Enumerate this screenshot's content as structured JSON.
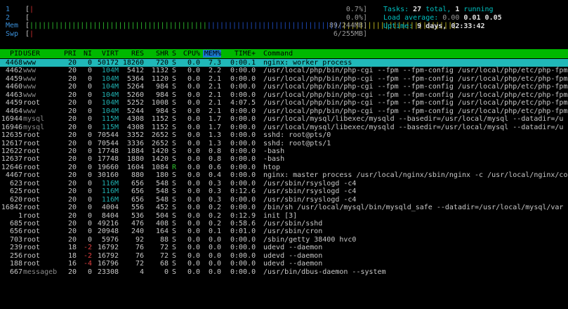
{
  "meters": [
    {
      "label": "1",
      "value": "0.7%]",
      "segments": [
        {
          "t": "|",
          "c": "#d03030"
        }
      ]
    },
    {
      "label": "2",
      "value": "0.0%]",
      "segments": []
    },
    {
      "label": "Mem",
      "value": "89/244MB]",
      "segments": [
        {
          "t": "||||||||||||||||||||||||||||||||||||||||||",
          "c": "#2fc02f"
        },
        {
          "t": "||||||||||||||||||||||||||||||||",
          "c": "#2050c8"
        },
        {
          "t": "|||||||||||||||||||||||||||",
          "c": "#c8c020"
        }
      ]
    },
    {
      "label": "Swp",
      "value": "6/255MB]",
      "segments": [
        {
          "t": "|",
          "c": "#d03030"
        }
      ]
    }
  ],
  "summary": {
    "tasks_label": "Tasks: ",
    "tasks_total": "27",
    "tasks_mid": " total, ",
    "tasks_running": "1",
    "tasks_end": " running",
    "load_label": "Load average: ",
    "load_1": "0.00",
    "load_5": "0.01",
    "load_15": "0.05",
    "uptime_label": "Uptime: ",
    "uptime_value": "9 days, 02:33:42"
  },
  "columns": {
    "pid": "PID",
    "user": "USER",
    "pri": "PRI",
    "ni": "NI",
    "virt": "VIRT",
    "res": "RES",
    "shr": "SHR",
    "s": "S",
    "cpu": "CPU%",
    "mem": "MEM%",
    "time": "TIME+",
    "command": "Command"
  },
  "processes": [
    {
      "pid": "4468",
      "user": "www",
      "pri": "20",
      "ni": "0",
      "virt": "50172",
      "res": "18260",
      "shr": "720",
      "s": "S",
      "cpu": "0.0",
      "mem": "7.3",
      "time": "0:00.13",
      "cmd": "nginx: worker process",
      "uc": "",
      "vc": "",
      "sc": ""
    },
    {
      "pid": "4462",
      "user": "www",
      "pri": "20",
      "ni": "0",
      "virt": "104M",
      "res": "5412",
      "shr": "1132",
      "s": "S",
      "cpu": "0.0",
      "mem": "2.2",
      "time": "0:00.01",
      "cmd": "/usr/local/php/bin/php-cgi --fpm --fpm-config /usr/local/php/etc/php-fpm",
      "uc": "gray",
      "vc": "cyan",
      "sc": ""
    },
    {
      "pid": "4459",
      "user": "www",
      "pri": "20",
      "ni": "0",
      "virt": "104M",
      "res": "5364",
      "shr": "1120",
      "s": "S",
      "cpu": "0.0",
      "mem": "2.1",
      "time": "0:00.01",
      "cmd": "/usr/local/php/bin/php-cgi --fpm --fpm-config /usr/local/php/etc/php-fpm",
      "uc": "gray",
      "vc": "cyan",
      "sc": ""
    },
    {
      "pid": "4460",
      "user": "www",
      "pri": "20",
      "ni": "0",
      "virt": "104M",
      "res": "5264",
      "shr": "984",
      "s": "S",
      "cpu": "0.0",
      "mem": "2.1",
      "time": "0:00.01",
      "cmd": "/usr/local/php/bin/php-cgi --fpm --fpm-config /usr/local/php/etc/php-fpm",
      "uc": "gray",
      "vc": "cyan",
      "sc": ""
    },
    {
      "pid": "4463",
      "user": "www",
      "pri": "20",
      "ni": "0",
      "virt": "104M",
      "res": "5260",
      "shr": "984",
      "s": "S",
      "cpu": "0.0",
      "mem": "2.1",
      "time": "0:00.01",
      "cmd": "/usr/local/php/bin/php-cgi --fpm --fpm-config /usr/local/php/etc/php-fpm",
      "uc": "gray",
      "vc": "cyan",
      "sc": ""
    },
    {
      "pid": "4459",
      "user": "root",
      "pri": "20",
      "ni": "0",
      "virt": "104M",
      "res": "5252",
      "shr": "1008",
      "s": "S",
      "cpu": "0.0",
      "mem": "2.1",
      "time": "4:07.55",
      "cmd": "/usr/local/php/bin/php-cgi --fpm --fpm-config /usr/local/php/etc/php-fpm",
      "uc": "",
      "vc": "cyan",
      "sc": ""
    },
    {
      "pid": "4464",
      "user": "www",
      "pri": "20",
      "ni": "0",
      "virt": "104M",
      "res": "5244",
      "shr": "984",
      "s": "S",
      "cpu": "0.0",
      "mem": "2.1",
      "time": "0:00.01",
      "cmd": "/usr/local/php/bin/php-cgi --fpm --fpm-config /usr/local/php/etc/php-fpm",
      "uc": "gray",
      "vc": "cyan",
      "sc": ""
    },
    {
      "pid": "16944",
      "user": "mysql",
      "pri": "20",
      "ni": "0",
      "virt": "115M",
      "res": "4308",
      "shr": "1152",
      "s": "S",
      "cpu": "0.0",
      "mem": "1.7",
      "time": "0:00.01",
      "cmd": "/usr/local/mysql/libexec/mysqld --basedir=/usr/local/mysql --datadir=/u",
      "uc": "gray",
      "vc": "cyan",
      "sc": ""
    },
    {
      "pid": "16946",
      "user": "mysql",
      "pri": "20",
      "ni": "0",
      "virt": "115M",
      "res": "4308",
      "shr": "1152",
      "s": "S",
      "cpu": "0.0",
      "mem": "1.7",
      "time": "0:00.00",
      "cmd": "/usr/local/mysql/libexec/mysqld --basedir=/usr/local/mysql --datadir=/u",
      "uc": "gray",
      "vc": "cyan",
      "sc": ""
    },
    {
      "pid": "12635",
      "user": "root",
      "pri": "20",
      "ni": "0",
      "virt": "70544",
      "res": "3352",
      "shr": "2652",
      "s": "S",
      "cpu": "0.0",
      "mem": "1.3",
      "time": "0:00.04",
      "cmd": "sshd: root@pts/0",
      "uc": "",
      "vc": "",
      "sc": ""
    },
    {
      "pid": "12617",
      "user": "root",
      "pri": "20",
      "ni": "0",
      "virt": "70544",
      "res": "3336",
      "shr": "2652",
      "s": "S",
      "cpu": "0.0",
      "mem": "1.3",
      "time": "0:00.04",
      "cmd": "sshd: root@pts/1",
      "uc": "",
      "vc": "",
      "sc": ""
    },
    {
      "pid": "12622",
      "user": "root",
      "pri": "20",
      "ni": "0",
      "virt": "17748",
      "res": "1884",
      "shr": "1420",
      "s": "S",
      "cpu": "0.0",
      "mem": "0.8",
      "time": "0:00.01",
      "cmd": "-bash",
      "uc": "",
      "vc": "",
      "sc": ""
    },
    {
      "pid": "12637",
      "user": "root",
      "pri": "20",
      "ni": "0",
      "virt": "17748",
      "res": "1880",
      "shr": "1420",
      "s": "S",
      "cpu": "0.0",
      "mem": "0.8",
      "time": "0:00.01",
      "cmd": "-bash",
      "uc": "",
      "vc": "",
      "sc": ""
    },
    {
      "pid": "12646",
      "user": "root",
      "pri": "20",
      "ni": "0",
      "virt": "19660",
      "res": "1604",
      "shr": "1084",
      "s": "R",
      "cpu": "0.0",
      "mem": "0.6",
      "time": "0:00.08",
      "cmd": "htop",
      "uc": "",
      "vc": "",
      "sc": "green"
    },
    {
      "pid": "4467",
      "user": "root",
      "pri": "20",
      "ni": "0",
      "virt": "30160",
      "res": "880",
      "shr": "180",
      "s": "S",
      "cpu": "0.0",
      "mem": "0.4",
      "time": "0:00.00",
      "cmd": "nginx: master process /usr/local/nginx/sbin/nginx -c /usr/local/nginx/co",
      "uc": "",
      "vc": "",
      "sc": ""
    },
    {
      "pid": "623",
      "user": "root",
      "pri": "20",
      "ni": "0",
      "virt": "116M",
      "res": "656",
      "shr": "548",
      "s": "S",
      "cpu": "0.0",
      "mem": "0.3",
      "time": "0:00.01",
      "cmd": "/usr/sbin/rsyslogd -c4",
      "uc": "",
      "vc": "cyan",
      "sc": ""
    },
    {
      "pid": "625",
      "user": "root",
      "pri": "20",
      "ni": "0",
      "virt": "116M",
      "res": "656",
      "shr": "548",
      "s": "S",
      "cpu": "0.0",
      "mem": "0.3",
      "time": "0:12.67",
      "cmd": "/usr/sbin/rsyslogd -c4",
      "uc": "",
      "vc": "cyan",
      "sc": ""
    },
    {
      "pid": "620",
      "user": "root",
      "pri": "20",
      "ni": "0",
      "virt": "116M",
      "res": "656",
      "shr": "548",
      "s": "S",
      "cpu": "0.0",
      "mem": "0.3",
      "time": "0:00.00",
      "cmd": "/usr/sbin/rsyslogd -c4",
      "uc": "",
      "vc": "cyan",
      "sc": ""
    },
    {
      "pid": "16842",
      "user": "root",
      "pri": "20",
      "ni": "0",
      "virt": "4004",
      "res": "556",
      "shr": "452",
      "s": "S",
      "cpu": "0.0",
      "mem": "0.2",
      "time": "0:00.01",
      "cmd": "/bin/sh /usr/local/mysql/bin/mysqld_safe --datadir=/usr/local/mysql/var",
      "uc": "",
      "vc": "",
      "sc": ""
    },
    {
      "pid": "1",
      "user": "root",
      "pri": "20",
      "ni": "0",
      "virt": "8404",
      "res": "536",
      "shr": "504",
      "s": "S",
      "cpu": "0.0",
      "mem": "0.2",
      "time": "0:12.91",
      "cmd": "init [3]",
      "uc": "",
      "vc": "",
      "sc": ""
    },
    {
      "pid": "685",
      "user": "root",
      "pri": "20",
      "ni": "0",
      "virt": "49216",
      "res": "476",
      "shr": "408",
      "s": "S",
      "cpu": "0.0",
      "mem": "0.2",
      "time": "0:58.67",
      "cmd": "/usr/sbin/sshd",
      "uc": "",
      "vc": "",
      "sc": ""
    },
    {
      "pid": "656",
      "user": "root",
      "pri": "20",
      "ni": "0",
      "virt": "20948",
      "res": "240",
      "shr": "164",
      "s": "S",
      "cpu": "0.0",
      "mem": "0.1",
      "time": "0:01.02",
      "cmd": "/usr/sbin/cron",
      "uc": "",
      "vc": "",
      "sc": ""
    },
    {
      "pid": "703",
      "user": "root",
      "pri": "20",
      "ni": "0",
      "virt": "5976",
      "res": "92",
      "shr": "88",
      "s": "S",
      "cpu": "0.0",
      "mem": "0.0",
      "time": "0:00.00",
      "cmd": "/sbin/getty 38400 hvc0",
      "uc": "",
      "vc": "",
      "sc": ""
    },
    {
      "pid": "239",
      "user": "root",
      "pri": "18",
      "ni": "-2",
      "virt": "16792",
      "res": "76",
      "shr": "72",
      "s": "S",
      "cpu": "0.0",
      "mem": "0.0",
      "time": "0:00.00",
      "cmd": "udevd --daemon",
      "uc": "",
      "vc": "",
      "sc": "",
      "nic": "red"
    },
    {
      "pid": "256",
      "user": "root",
      "pri": "18",
      "ni": "-2",
      "virt": "16792",
      "res": "76",
      "shr": "72",
      "s": "S",
      "cpu": "0.0",
      "mem": "0.0",
      "time": "0:00.00",
      "cmd": "udevd --daemon",
      "uc": "",
      "vc": "",
      "sc": "",
      "nic": "red"
    },
    {
      "pid": "188",
      "user": "root",
      "pri": "16",
      "ni": "-4",
      "virt": "16796",
      "res": "72",
      "shr": "68",
      "s": "S",
      "cpu": "0.0",
      "mem": "0.0",
      "time": "0:00.03",
      "cmd": "udevd --daemon",
      "uc": "",
      "vc": "",
      "sc": "",
      "nic": "red"
    },
    {
      "pid": "667",
      "user": "messageb",
      "pri": "20",
      "ni": "0",
      "virt": "23308",
      "res": "4",
      "shr": "0",
      "s": "S",
      "cpu": "0.0",
      "mem": "0.0",
      "time": "0:00.00",
      "cmd": "/usr/bin/dbus-daemon --system",
      "uc": "gray",
      "vc": "",
      "sc": ""
    }
  ]
}
